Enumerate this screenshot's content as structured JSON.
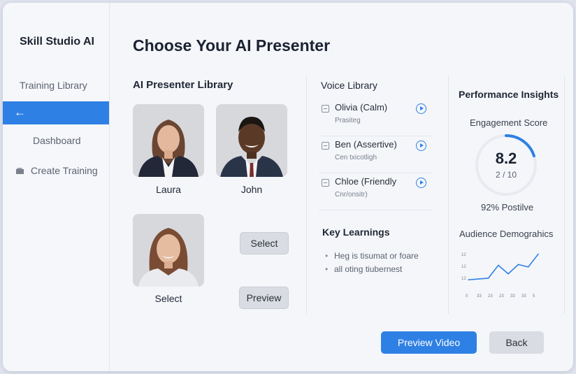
{
  "sidebar": {
    "app_title": "Skill Studio AI",
    "items": [
      {
        "label": "Training Library"
      },
      {
        "label": ""
      },
      {
        "label": "Dashboard"
      },
      {
        "label": "Create Training"
      }
    ],
    "back_icon": "arrow-left-icon",
    "create_icon": "folder-icon"
  },
  "page": {
    "title": "Choose Your AI Presenter"
  },
  "presenter_library": {
    "title": "AI Presenter Library",
    "presenters": [
      {
        "name": "Laura"
      },
      {
        "name": "John"
      },
      {
        "name": "Select"
      }
    ],
    "select_label": "Select",
    "preview_label": "Preview"
  },
  "voice_library": {
    "title": "Voice Library",
    "voices": [
      {
        "name": "Olivia (Calm)",
        "sub": "Prasiteg"
      },
      {
        "name": "Ben (Assertive)",
        "sub": "Cen txicotligh"
      },
      {
        "name": "Chloe (Friendly",
        "sub": "Cnr/onsitr)"
      }
    ]
  },
  "key_learnings": {
    "title": "Key Learnings",
    "items": [
      "Heg is tisumat or foare",
      "all oting tiubernest"
    ]
  },
  "insights": {
    "title": "Performance Insights",
    "engagement_label": "Engagement Score",
    "score": "8.2",
    "score_sub": "2 / 10",
    "score_fraction": 0.2,
    "positive_label": "92% Postilve",
    "demographics_label": "Audience Demograhics",
    "accent_color": "#2f80e4"
  },
  "chart_data": {
    "type": "line",
    "title": "Audience Demograhics",
    "x_ticks": [
      "0",
      "33",
      "23",
      "23",
      "33",
      "33",
      "5"
    ],
    "y_ticks": [
      "12",
      "12",
      "12"
    ],
    "values": [
      1,
      1.2,
      1.4,
      4.6,
      2.5,
      4.8,
      4.2,
      7.4
    ]
  },
  "footer": {
    "preview_video_label": "Preview Video",
    "back_label": "Back"
  }
}
